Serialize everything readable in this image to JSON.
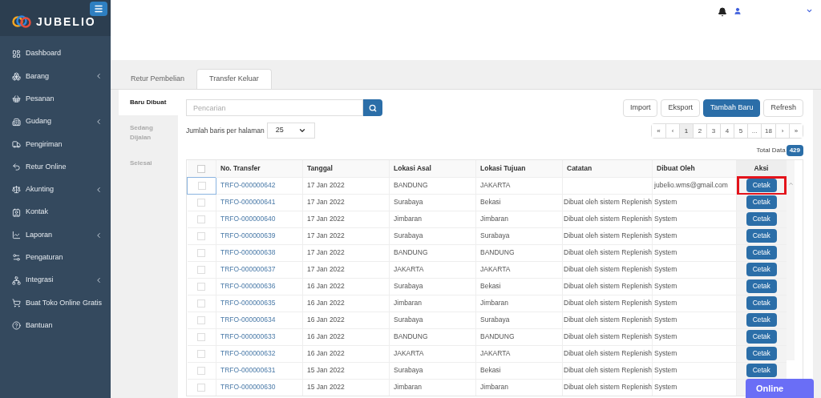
{
  "brand": {
    "name": "JUBELIO"
  },
  "sidebar": {
    "items": [
      {
        "label": "Dashboard",
        "has_submenu": false
      },
      {
        "label": "Barang",
        "has_submenu": true
      },
      {
        "label": "Pesanan",
        "has_submenu": false
      },
      {
        "label": "Gudang",
        "has_submenu": true
      },
      {
        "label": "Pengiriman",
        "has_submenu": false
      },
      {
        "label": "Retur Online",
        "has_submenu": false
      },
      {
        "label": "Akunting",
        "has_submenu": true
      },
      {
        "label": "Kontak",
        "has_submenu": false
      },
      {
        "label": "Laporan",
        "has_submenu": true
      },
      {
        "label": "Pengaturan",
        "has_submenu": false
      },
      {
        "label": "Integrasi",
        "has_submenu": true
      },
      {
        "label": "Buat Toko Online Gratis",
        "has_submenu": false
      },
      {
        "label": "Bantuan",
        "has_submenu": false
      }
    ]
  },
  "tabs": [
    {
      "label": "Retur Pembelian",
      "selected": false
    },
    {
      "label": "Transfer Keluar",
      "selected": true
    }
  ],
  "status_tabs": [
    {
      "label": "Baru Dibuat",
      "selected": true
    },
    {
      "label": "Sedang Dijalan",
      "selected": false
    },
    {
      "label": "Selesai",
      "selected": false
    }
  ],
  "search": {
    "placeholder": "Pencarian"
  },
  "page_size": {
    "label": "Jumlah baris per halaman",
    "value": "25"
  },
  "actions": [
    {
      "label": "Import",
      "primary": false
    },
    {
      "label": "Eksport",
      "primary": false
    },
    {
      "label": "Tambah Baru",
      "primary": true
    },
    {
      "label": "Refresh",
      "primary": false
    }
  ],
  "pagination": [
    {
      "label": "«",
      "selected": false
    },
    {
      "label": "‹",
      "selected": false
    },
    {
      "label": "1",
      "selected": true
    },
    {
      "label": "2",
      "selected": false
    },
    {
      "label": "3",
      "selected": false
    },
    {
      "label": "4",
      "selected": false
    },
    {
      "label": "5",
      "selected": false
    },
    {
      "label": "...",
      "selected": false
    },
    {
      "label": "18",
      "selected": false
    },
    {
      "label": "›",
      "selected": false
    },
    {
      "label": "»",
      "selected": false
    }
  ],
  "total": {
    "label": "Total Data",
    "value": "429"
  },
  "table": {
    "select_all_checked": false,
    "columns": [
      "No. Transfer",
      "Tanggal",
      "Lokasi Asal",
      "Lokasi Tujuan",
      "Catatan",
      "Dibuat Oleh",
      "Aksi"
    ],
    "rows": [
      {
        "no": "TRFO-000000642",
        "date": "17 Jan 2022",
        "from": "BANDUNG",
        "to": "JAKARTA",
        "note": "",
        "by": "jubelio.wms@gmail.com",
        "action": "Cetak",
        "focused": true,
        "highlighted": true
      },
      {
        "no": "TRFO-000000641",
        "date": "17 Jan 2022",
        "from": "Surabaya",
        "to": "Bekasi",
        "note": "Dibuat oleh sistem Replenish",
        "by": "System",
        "action": "Cetak",
        "focused": false,
        "highlighted": false
      },
      {
        "no": "TRFO-000000640",
        "date": "17 Jan 2022",
        "from": "Jimbaran",
        "to": "Jimbaran",
        "note": "Dibuat oleh sistem Replenish",
        "by": "System",
        "action": "Cetak",
        "focused": false,
        "highlighted": false
      },
      {
        "no": "TRFO-000000639",
        "date": "17 Jan 2022",
        "from": "Surabaya",
        "to": "Surabaya",
        "note": "Dibuat oleh sistem Replenish",
        "by": "System",
        "action": "Cetak",
        "focused": false,
        "highlighted": false
      },
      {
        "no": "TRFO-000000638",
        "date": "17 Jan 2022",
        "from": "BANDUNG",
        "to": "BANDUNG",
        "note": "Dibuat oleh sistem Replenish",
        "by": "System",
        "action": "Cetak",
        "focused": false,
        "highlighted": false
      },
      {
        "no": "TRFO-000000637",
        "date": "17 Jan 2022",
        "from": "JAKARTA",
        "to": "JAKARTA",
        "note": "Dibuat oleh sistem Replenish",
        "by": "System",
        "action": "Cetak",
        "focused": false,
        "highlighted": false
      },
      {
        "no": "TRFO-000000636",
        "date": "16 Jan 2022",
        "from": "Surabaya",
        "to": "Bekasi",
        "note": "Dibuat oleh sistem Replenish",
        "by": "System",
        "action": "Cetak",
        "focused": false,
        "highlighted": false
      },
      {
        "no": "TRFO-000000635",
        "date": "16 Jan 2022",
        "from": "Jimbaran",
        "to": "Jimbaran",
        "note": "Dibuat oleh sistem Replenish",
        "by": "System",
        "action": "Cetak",
        "focused": false,
        "highlighted": false
      },
      {
        "no": "TRFO-000000634",
        "date": "16 Jan 2022",
        "from": "Surabaya",
        "to": "Surabaya",
        "note": "Dibuat oleh sistem Replenish",
        "by": "System",
        "action": "Cetak",
        "focused": false,
        "highlighted": false
      },
      {
        "no": "TRFO-000000633",
        "date": "16 Jan 2022",
        "from": "BANDUNG",
        "to": "BANDUNG",
        "note": "Dibuat oleh sistem Replenish",
        "by": "System",
        "action": "Cetak",
        "focused": false,
        "highlighted": false
      },
      {
        "no": "TRFO-000000632",
        "date": "16 Jan 2022",
        "from": "JAKARTA",
        "to": "JAKARTA",
        "note": "Dibuat oleh sistem Replenish",
        "by": "System",
        "action": "Cetak",
        "focused": false,
        "highlighted": false
      },
      {
        "no": "TRFO-000000631",
        "date": "15 Jan 2022",
        "from": "Surabaya",
        "to": "Bekasi",
        "note": "Dibuat oleh sistem Replenish",
        "by": "System",
        "action": "Cetak",
        "focused": false,
        "highlighted": false
      },
      {
        "no": "TRFO-000000630",
        "date": "15 Jan 2022",
        "from": "Jimbaran",
        "to": "Jimbaran",
        "note": "Dibuat oleh sistem Replenish",
        "by": "System",
        "focused": false,
        "highlighted": false
      }
    ]
  },
  "chat": {
    "label": "Online"
  }
}
